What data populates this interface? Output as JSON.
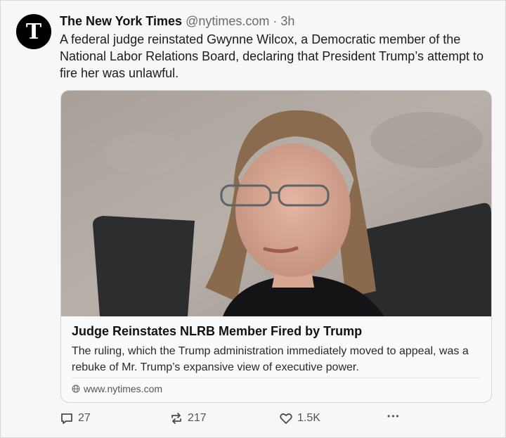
{
  "post": {
    "avatar_glyph": "T",
    "author_name": "The New York Times",
    "handle": "@nytimes.com",
    "separator": "·",
    "time": "3h",
    "text": "A federal judge reinstated Gwynne Wilcox, a Democratic member of the National Labor Relations Board, declaring that President Trump’s attempt to fire her was unlawful."
  },
  "card": {
    "title": "Judge Reinstates NLRB Member Fired by Trump",
    "description": "The ruling, which the Trump administration immediately moved to appeal, was a rebuke of Mr. Trump’s expansive view of executive power.",
    "domain": "www.nytimes.com",
    "link_icon": "globe-icon"
  },
  "actions": {
    "replies": "27",
    "reposts": "217",
    "likes": "1.5K",
    "more": "•••"
  },
  "colors": {
    "text": "#1a1a1a",
    "muted": "#6b6b6b",
    "border": "#d4d4d4"
  }
}
